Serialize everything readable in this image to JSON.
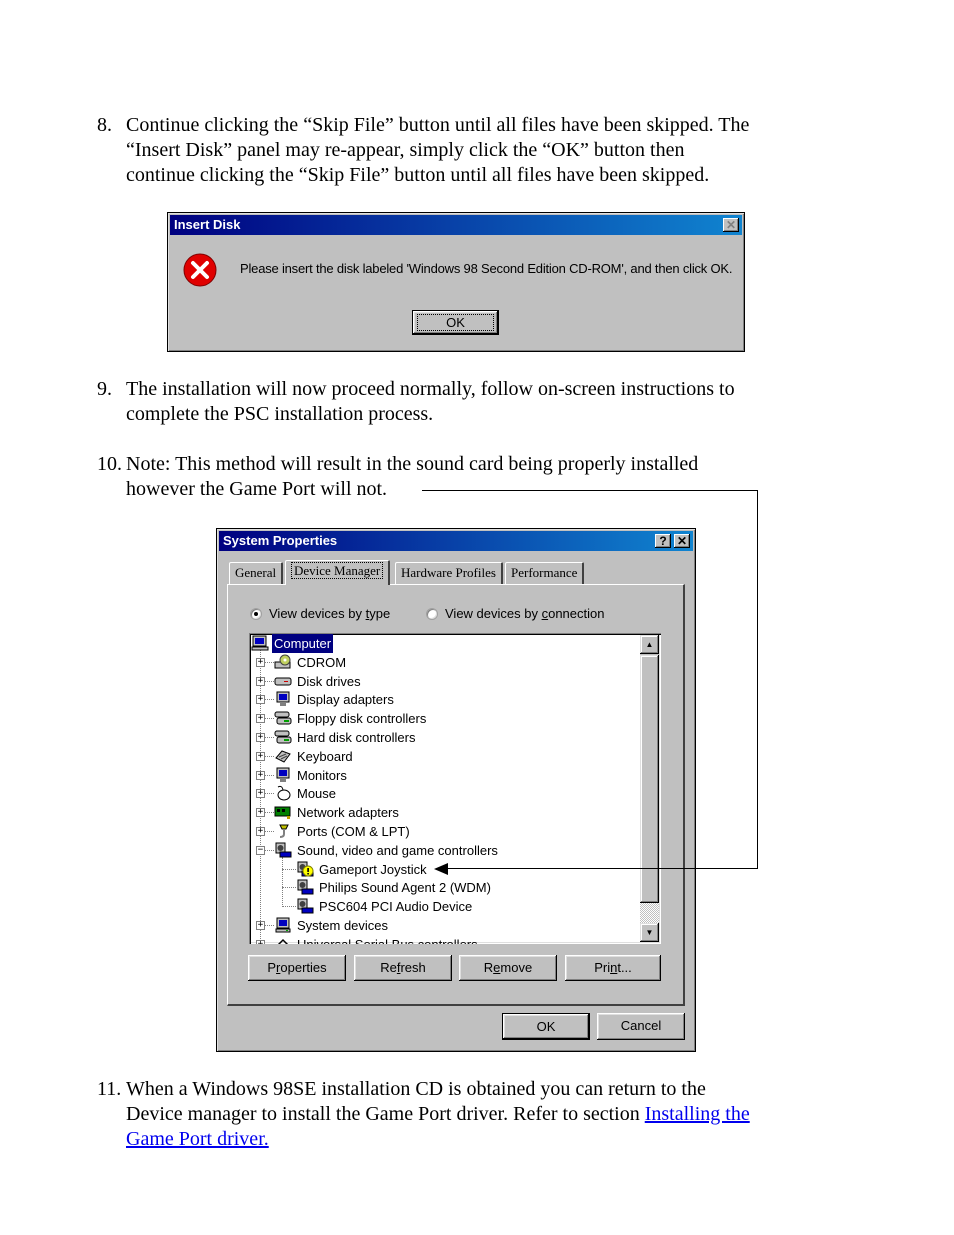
{
  "steps": [
    {
      "number": "8.",
      "lines": [
        "Continue clicking the “Skip File” button until all files have been skipped. The",
        "“Insert Disk” panel may re-appear, simply click the “OK” button then",
        "continue clicking the “Skip File” button until all files have been skipped."
      ]
    },
    {
      "number": "9.",
      "lines": [
        "The installation will now proceed normally, follow on-screen instructions to",
        "complete the PSC installation process."
      ]
    },
    {
      "number": "10.",
      "lines": [
        "Note: This method will result in the sound card being properly installed",
        "however the Game Port will not."
      ]
    },
    {
      "number": "11.",
      "lines": [
        "When a Windows 98SE installation CD is obtained you can return to the",
        "Device manager to install the Game Port driver. Refer to section "
      ],
      "link_part1": "Installing the",
      "link_part2": "Game Port driver."
    }
  ],
  "insert_disk_dialog": {
    "title": "Insert Disk",
    "icon": "error-icon",
    "message": "Please insert the disk labeled 'Windows 98 Second Edition CD-ROM', and then click OK.",
    "ok_label": "OK",
    "close_icon": "close-icon"
  },
  "system_properties": {
    "title": "System Properties",
    "help_glyph": "?",
    "close_glyph": "✕",
    "tabs": [
      {
        "label": "General",
        "active": false
      },
      {
        "label": "Device Manager",
        "active": true
      },
      {
        "label": "Hardware Profiles",
        "active": false
      },
      {
        "label": "Performance",
        "active": false
      }
    ],
    "radio_type": {
      "pre": "View devices by ",
      "accel": "t",
      "post": "ype",
      "checked": true
    },
    "radio_connection": {
      "pre": "View devices by ",
      "accel": "c",
      "post": "onnection",
      "checked": false
    },
    "tree": [
      {
        "label": "Computer",
        "level": 0,
        "icon": "computer-icon",
        "expander": "",
        "selected": true
      },
      {
        "label": "CDROM",
        "level": 1,
        "icon": "cdrom-icon",
        "expander": "+"
      },
      {
        "label": "Disk drives",
        "level": 1,
        "icon": "disk-drive-icon",
        "expander": "+"
      },
      {
        "label": "Display adapters",
        "level": 1,
        "icon": "display-adapter-icon",
        "expander": "+"
      },
      {
        "label": "Floppy disk controllers",
        "level": 1,
        "icon": "floppy-controller-icon",
        "expander": "+"
      },
      {
        "label": "Hard disk controllers",
        "level": 1,
        "icon": "hard-disk-controller-icon",
        "expander": "+"
      },
      {
        "label": "Keyboard",
        "level": 1,
        "icon": "keyboard-icon",
        "expander": "+"
      },
      {
        "label": "Monitors",
        "level": 1,
        "icon": "monitor-icon",
        "expander": "+"
      },
      {
        "label": "Mouse",
        "level": 1,
        "icon": "mouse-icon",
        "expander": "+"
      },
      {
        "label": "Network adapters",
        "level": 1,
        "icon": "network-adapter-icon",
        "expander": "+"
      },
      {
        "label": "Ports (COM & LPT)",
        "level": 1,
        "icon": "port-icon",
        "expander": "+"
      },
      {
        "label": "Sound, video and game controllers",
        "level": 1,
        "icon": "sound-controller-icon",
        "expander": "−"
      },
      {
        "label": "Gameport Joystick",
        "level": 2,
        "icon": "warning-device-icon",
        "expander": ""
      },
      {
        "label": "Philips Sound Agent 2 (WDM)",
        "level": 2,
        "icon": "sound-device-icon",
        "expander": ""
      },
      {
        "label": "PSC604 PCI Audio Device",
        "level": 2,
        "icon": "sound-device-icon",
        "expander": ""
      },
      {
        "label": "System devices",
        "level": 1,
        "icon": "system-device-icon",
        "expander": "+"
      },
      {
        "label": "Universal Serial Bus controllers",
        "level": 1,
        "icon": "usb-icon",
        "expander": "+"
      }
    ],
    "buttons": {
      "properties": {
        "pre": "P",
        "accel": "r",
        "post": "operties"
      },
      "refresh": {
        "pre": "Re",
        "accel": "f",
        "post": "resh"
      },
      "remove": {
        "pre": "R",
        "accel": "e",
        "post": "move"
      },
      "print": {
        "pre": "Pri",
        "accel": "n",
        "post": "t..."
      }
    },
    "ok_label": "OK",
    "cancel_label": "Cancel"
  },
  "colors": {
    "title_gradient_start": "#000080",
    "title_gradient_end": "#1084d0",
    "dialog_face": "#c0c0c0",
    "link": "#0000ee",
    "selection": "#000080"
  }
}
